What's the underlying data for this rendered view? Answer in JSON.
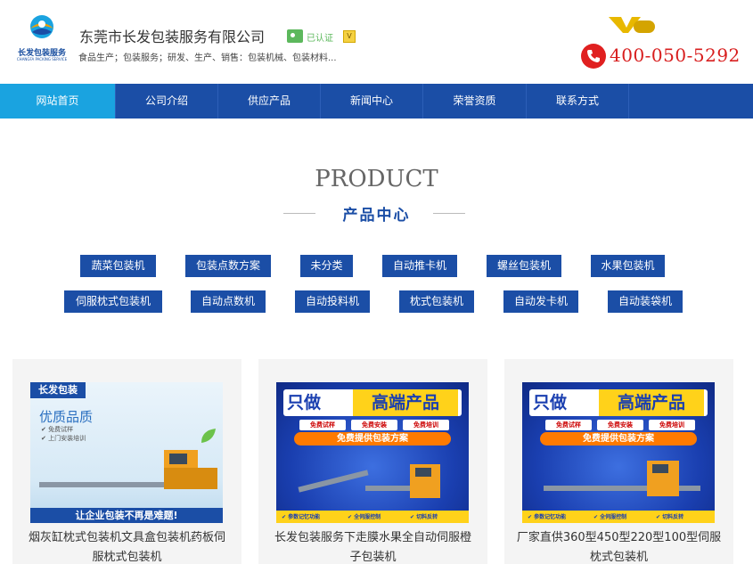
{
  "header": {
    "logo_text": "长发包装服务",
    "logo_subtext": "CHANGFA PACKING SERVICE",
    "company_name": "东莞市长发包装服务有限公司",
    "cert_label": "已认证",
    "v_label": "V",
    "business_scope": "食品生产；包装服务；研发、生产、销售：包装机械、包装材料...",
    "phone": "400-050-5292",
    "colors": {
      "brand": "#1b4ea6",
      "phone": "#d81e1e",
      "nav_active": "#1aa3e0"
    }
  },
  "nav": {
    "items": [
      {
        "label": "网站首页",
        "active": true
      },
      {
        "label": "公司介绍",
        "active": false
      },
      {
        "label": "供应产品",
        "active": false
      },
      {
        "label": "新闻中心",
        "active": false
      },
      {
        "label": "荣誉资质",
        "active": false
      },
      {
        "label": "联系方式",
        "active": false
      }
    ]
  },
  "products": {
    "title_en": "PRODUCT",
    "title_cn": "产品中心",
    "categories_row1": [
      "蔬菜包装机",
      "包装点数方案",
      "未分类",
      "自动推卡机",
      "螺丝包装机",
      "水果包装机"
    ],
    "categories_row2": [
      "伺服枕式包装机",
      "自动点数机",
      "自动投料机",
      "枕式包装机",
      "自动发卡机",
      "自动装袋机"
    ],
    "cards": [
      {
        "title": "烟灰缸枕式包装机文具盒包装机药板伺服枕式包装机",
        "image": {
          "brand": "长发包装",
          "headline": "优质品质",
          "line1": "✔ 免费试样",
          "line2": "✔ 上门安装培训",
          "bottom": "让企业包装不再是难题!"
        }
      },
      {
        "title": "长发包装服务下走膜水果全自动伺服橙子包装机",
        "image": {
          "banner_a": "只做",
          "banner_b": "高端产品",
          "tags": [
            "免费试样",
            "免费安装",
            "免费培训"
          ],
          "solution": "免费提供包装方案",
          "features": [
            "✔ 参数记忆功能",
            "✔ 全伺服控制",
            "✔ 切料反转"
          ]
        }
      },
      {
        "title": "厂家直供360型450型220型100型伺服枕式包装机",
        "image": {
          "banner_a": "只做",
          "banner_b": "高端产品",
          "tags": [
            "免费试样",
            "免费安装",
            "免费培训"
          ],
          "solution": "免费提供包装方案",
          "features": [
            "✔ 参数记忆功能",
            "✔ 全伺服控制",
            "✔ 切料反转"
          ]
        }
      }
    ]
  }
}
